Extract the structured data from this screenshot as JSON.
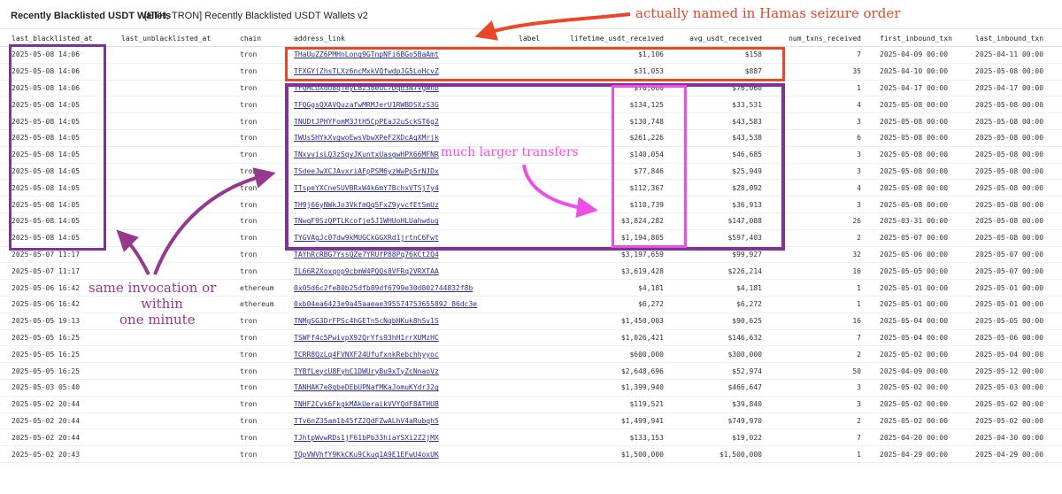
{
  "header": {
    "title": "Recently Blacklisted USDT Wallets",
    "subtitle": "[ETH, TRON] Recently Blacklisted USDT Wallets v2"
  },
  "table": {
    "columns": [
      "last_blacklisted_at",
      "last_unblacklisted_at",
      "chain",
      "address_link",
      "label",
      "lifetime_usdt_received",
      "avg_usdt_received",
      "num_txns_received",
      "first_inbound_txn",
      "last_inbound_txn"
    ],
    "rows": [
      [
        "2025-05-08 14:06",
        "",
        "tron",
        "THaUuZZ6PMHnLong9GTnpNFi6BGo5BaAmt",
        "",
        "$1,106",
        "$158",
        "7",
        "2025-04-09 00:00",
        "2025-04-11 00:00"
      ],
      [
        "2025-05-08 14:06",
        "",
        "tron",
        "TFXGYjZhsTLXz6ncMxkVQfwdpJG5LoHcvZ",
        "",
        "$31,053",
        "$887",
        "35",
        "2025-04-10 00:00",
        "2025-05-08 00:00"
      ],
      [
        "2025-05-08 14:06",
        "",
        "tron",
        "TFQMLUXdo8qfeyLB238euC7Dqd3N7VgWnb",
        "",
        "$76,060",
        "$76,060",
        "1",
        "2025-04-17 00:00",
        "2025-04-17 00:00"
      ],
      [
        "2025-05-08 14:05",
        "",
        "tron",
        "TFQGgsQXAVQuzafwMRMJerU1RWBDSXzS3G",
        "",
        "$134,125",
        "$33,531",
        "4",
        "2025-05-08 00:00",
        "2025-05-08 00:00"
      ],
      [
        "2025-05-08 14:05",
        "",
        "tron",
        "TNUDtJPHYFomM3JtH5CpPEaJ2uSckST6g2",
        "",
        "$130,748",
        "$43,583",
        "3",
        "2025-05-08 00:00",
        "2025-05-08 00:00"
      ],
      [
        "2025-05-08 14:05",
        "",
        "tron",
        "TWUsSHYkXvgwoEwsVbwXPeF2XDcAqXMrjk",
        "",
        "$261,226",
        "$43,538",
        "6",
        "2025-05-08 00:00",
        "2025-05-08 00:00"
      ],
      [
        "2025-05-08 14:05",
        "",
        "tron",
        "TNxyvisLQ3zSqyJKuntxUasgwHPX66MFNR",
        "",
        "$140,054",
        "$46,685",
        "3",
        "2025-05-08 00:00",
        "2025-05-08 00:00"
      ],
      [
        "2025-05-08 14:05",
        "",
        "tron",
        "TSdeeJwXCJAvxriAFpPSM6yzWwPp5rNJDx",
        "",
        "$77,846",
        "$25,949",
        "3",
        "2025-05-08 00:00",
        "2025-05-08 00:00"
      ],
      [
        "2025-05-08 14:05",
        "",
        "tron",
        "TTspeYXCneSUVBRxW4k6mY7BchxVTSj7y4",
        "",
        "$112,367",
        "$28,092",
        "4",
        "2025-05-08 00:00",
        "2025-05-08 00:00"
      ],
      [
        "2025-05-08 14:05",
        "",
        "tron",
        "TH9j66yNWkJo3VkfmQq5FxZ9yvcfEtSmUz",
        "",
        "$110,739",
        "$36,913",
        "3",
        "2025-05-08 00:00",
        "2025-05-08 00:00"
      ],
      [
        "2025-05-08 14:05",
        "",
        "tron",
        "TNwqF9SzQPTLKcofje5J1WHUoHLUahwdug",
        "",
        "$3,824,282",
        "$147,088",
        "26",
        "2025-03-31 00:00",
        "2025-05-08 00:00"
      ],
      [
        "2025-05-08 14:05",
        "",
        "tron",
        "TYGVAgJc07dw9kMUGCkGGXRd1jrtnC6Fwt",
        "",
        "$1,194,805",
        "$597,403",
        "2",
        "2025-05-07 00:00",
        "2025-05-08 00:00"
      ],
      [
        "2025-05-07 11:17",
        "",
        "tron",
        "TAYhRcRBG7YssQZe7YRUfP88Pq76kCt2Q4",
        "",
        "$3,197,659",
        "$99,927",
        "32",
        "2025-05-06 00:00",
        "2025-05-07 00:00"
      ],
      [
        "2025-05-07 11:17",
        "",
        "tron",
        "TL66R2Xoxqop9cbmW4PQQs8VFRq2VRXTAA",
        "",
        "$3,619,428",
        "$226,214",
        "16",
        "2025-05-05 00:00",
        "2025-05-07 00:00"
      ],
      [
        "2025-05-06 16:42",
        "",
        "ethereum",
        "0x05d6c2fe80b25dfb89df6799e30d802744832f8b",
        "",
        "$4,181",
        "$4,181",
        "1",
        "2025-05-01 00:00",
        "2025-05-01 00:00"
      ],
      [
        "2025-05-06 16:42",
        "",
        "ethereum",
        "0xb04ea6423e9a45aaeae395574753655892 86dc3e",
        "",
        "$6,272",
        "$6,272",
        "1",
        "2025-05-01 00:00",
        "2025-05-01 00:00"
      ],
      [
        "2025-05-05 19:13",
        "",
        "tron",
        "TNMgSG3DrFPSc4hGETn5cNqbHKuk8hSv1S",
        "",
        "$1,450,003",
        "$90,625",
        "16",
        "2025-05-04 00:00",
        "2025-05-05 00:00"
      ],
      [
        "2025-05-05 16:25",
        "",
        "tron",
        "TSWFf4c5PwivpX92QrYfs93hH1rrXUMzHC",
        "",
        "$1,026,421",
        "$146,632",
        "7",
        "2025-05-04 00:00",
        "2025-05-06 00:00"
      ],
      [
        "2025-05-05 16:25",
        "",
        "tron",
        "TCRR8QzLq4FVNXF24UfufxnkRebchhyyoc",
        "",
        "$600,000",
        "$300,000",
        "2",
        "2025-05-02 00:00",
        "2025-05-04 00:00"
      ],
      [
        "2025-05-05 16:25",
        "",
        "tron",
        "TYBfLeycU8FyhC1DWUryBu9xTyZcNnaoVz",
        "",
        "$2,648,696",
        "$52,974",
        "50",
        "2025-04-09 00:00",
        "2025-05-12 00:00"
      ],
      [
        "2025-05-03 05:40",
        "",
        "tron",
        "TANHAK7e8qbeDEbUPNafMKaJomuKYdr32g",
        "",
        "$1,399,940",
        "$466,647",
        "3",
        "2025-05-02 00:00",
        "2025-05-03 00:00"
      ],
      [
        "2025-05-02 20:44",
        "",
        "tron",
        "TNHF2Cvk6FkgkMAkUeraikVVYQdF8ATHUB",
        "",
        "$119,521",
        "$39,840",
        "3",
        "2025-05-02 00:00",
        "2025-05-02 00:00"
      ],
      [
        "2025-05-02 20:44",
        "",
        "tron",
        "TTv6nZ35am1b45fZ2QdFZwALhV4aRubqh5",
        "",
        "$1,499,941",
        "$749,970",
        "2",
        "2025-05-02 00:00",
        "2025-05-02 00:00"
      ],
      [
        "2025-05-02 20:44",
        "",
        "tron",
        "TJhtpWvwRDs1jF61bPb33hiaYSXi2Z2jMX",
        "",
        "$133,153",
        "$19,022",
        "7",
        "2025-04-20 00:00",
        "2025-04-30 00:00"
      ],
      [
        "2025-05-02 20:43",
        "",
        "tron",
        "TQpVWVhfY9KkCKu9Ckuq1A9E1EFwU4oxUK",
        "",
        "$1,500,000",
        "$1,500,000",
        "1",
        "2025-04-29 00:00",
        "2025-04-29 00:00"
      ]
    ]
  },
  "annotations": {
    "hamas_note": "actually named in Hamas seizure order",
    "transfers_note": "much larger transfers",
    "invocation_note": [
      "same invocation or",
      "within",
      "one minute"
    ]
  },
  "colors": {
    "hamas": "#e8472a",
    "group": "#7a3596",
    "transfers": "#ee4de8",
    "invocation": "#96388f",
    "link": "#2b2b8f"
  }
}
